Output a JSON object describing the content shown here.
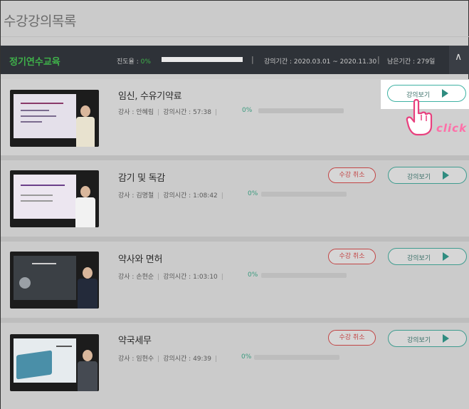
{
  "page": {
    "title": "수강강의목록"
  },
  "course": {
    "name": "정기연수교육",
    "progress_label": "진도율 : ",
    "progress_value": "0%",
    "progress_fraction": 0,
    "period": "강의기간 : 2020.03.01 ~ 2020.11.30",
    "remaining": "남은기간 : 279일",
    "separator": "|",
    "collapse_icon": "chevron-up-icon",
    "collapse_glyph": "∧"
  },
  "lectures": [
    {
      "title": "임신, 수유기약료",
      "instructor": "강사 : 안혜림",
      "duration": "강의시간 : 57:38",
      "progress": "0%",
      "progress_fraction": 0,
      "cancel_label": "",
      "view_label": "강의보기",
      "thumb_slide_title": "임신, 수유부 약료"
    },
    {
      "title": "감기 및 독감",
      "instructor": "강사 : 김명철",
      "duration": "강의시간 : 1:08:42",
      "progress": "0%",
      "progress_fraction": 0,
      "cancel_label": "수강 취소",
      "view_label": "강의보기",
      "thumb_slide_title": "감기 및 독감의 이해와 약료"
    },
    {
      "title": "약사와 면허",
      "instructor": "강사 : 손현순",
      "duration": "강의시간 : 1:03:10",
      "progress": "0%",
      "progress_fraction": 0,
      "cancel_label": "수강 취소",
      "view_label": "강의보기",
      "thumb_slide_title": "약사와 면허"
    },
    {
      "title": "약국세무",
      "instructor": "강사 : 임현수",
      "duration": "강의시간 : 49:39",
      "progress": "0%",
      "progress_fraction": 0,
      "cancel_label": "수강 취소",
      "view_label": "강의보기",
      "thumb_slide_title": "약국세무"
    }
  ],
  "annotation": {
    "click_text": "click"
  },
  "colors": {
    "accent_green": "#3fb24a",
    "teal_button": "#3f9c8f",
    "cancel_red": "#c24545",
    "click_pink": "#ff6fa8",
    "bar_dark": "#2e3238"
  }
}
